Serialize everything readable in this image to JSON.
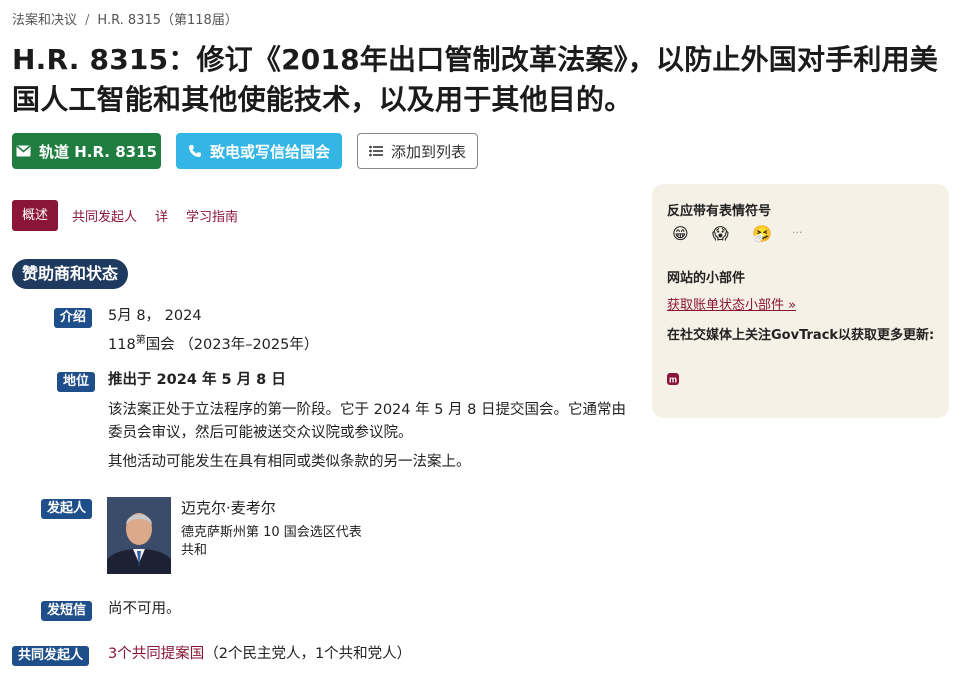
{
  "breadcrumb": {
    "parent": "法案和决议",
    "separator": "/",
    "current": "H.R. 8315（第118届）"
  },
  "page_title": "H.R. 8315：修订《2018年出口管制改革法案》，以防止外国对手利用美国人工智能和其他使能技术，以及用于其他目的。",
  "actions": {
    "track": "轨道 H.R. 8315",
    "call": "致电或写信给国会",
    "add_list": "添加到列表"
  },
  "tabs": {
    "overview": "概述",
    "cosponsors": "共同发起人",
    "details": "详",
    "study_guide": "学习指南"
  },
  "section_title": "赞助商和状态",
  "introduced": {
    "label": "介绍",
    "date": "5月 8， 2024",
    "congress_prefix": "118",
    "congress_sup": "第",
    "congress_suffix": "国会 （2023年–2025年）"
  },
  "status": {
    "label": "地位",
    "headline": "推出于 2024 年 5 月 8 日",
    "desc1": "该法案正处于立法程序的第一阶段。它于 2024 年 5 月 8 日提交国会。它通常由委员会审议，然后可能被送交众议院或参议院。",
    "desc2": "其他活动可能发生在具有相同或类似条款的另一法案上。"
  },
  "sponsor": {
    "label": "发起人",
    "name": "迈克尔·麦考尔",
    "role": "德克萨斯州第 10 国会选区代表",
    "party": "共和"
  },
  "text_section": {
    "label": "发短信",
    "value": "尚不可用。"
  },
  "cosponsors": {
    "label": "共同发起人",
    "link": "3个共同提案国",
    "detail": "（2个民主党人，1个共和党人）"
  },
  "sidebar": {
    "reactions_title": "反应带有表情符号",
    "reactions": [
      "😁",
      "😱",
      "🤧",
      "···"
    ],
    "widgets_title": "网站的小部件",
    "widget_link": "获取账单状态小部件 »",
    "social_title": "在社交媒体上关注GovTrack以获取更多更新:",
    "social_icon": "mastodon-icon"
  },
  "colors": {
    "brand_red": "#8a1538",
    "track_green": "#1e7d3f",
    "call_blue": "#33b5e5",
    "label_blue": "#1f4f8a",
    "sidebar_bg": "#f6f1e6"
  }
}
